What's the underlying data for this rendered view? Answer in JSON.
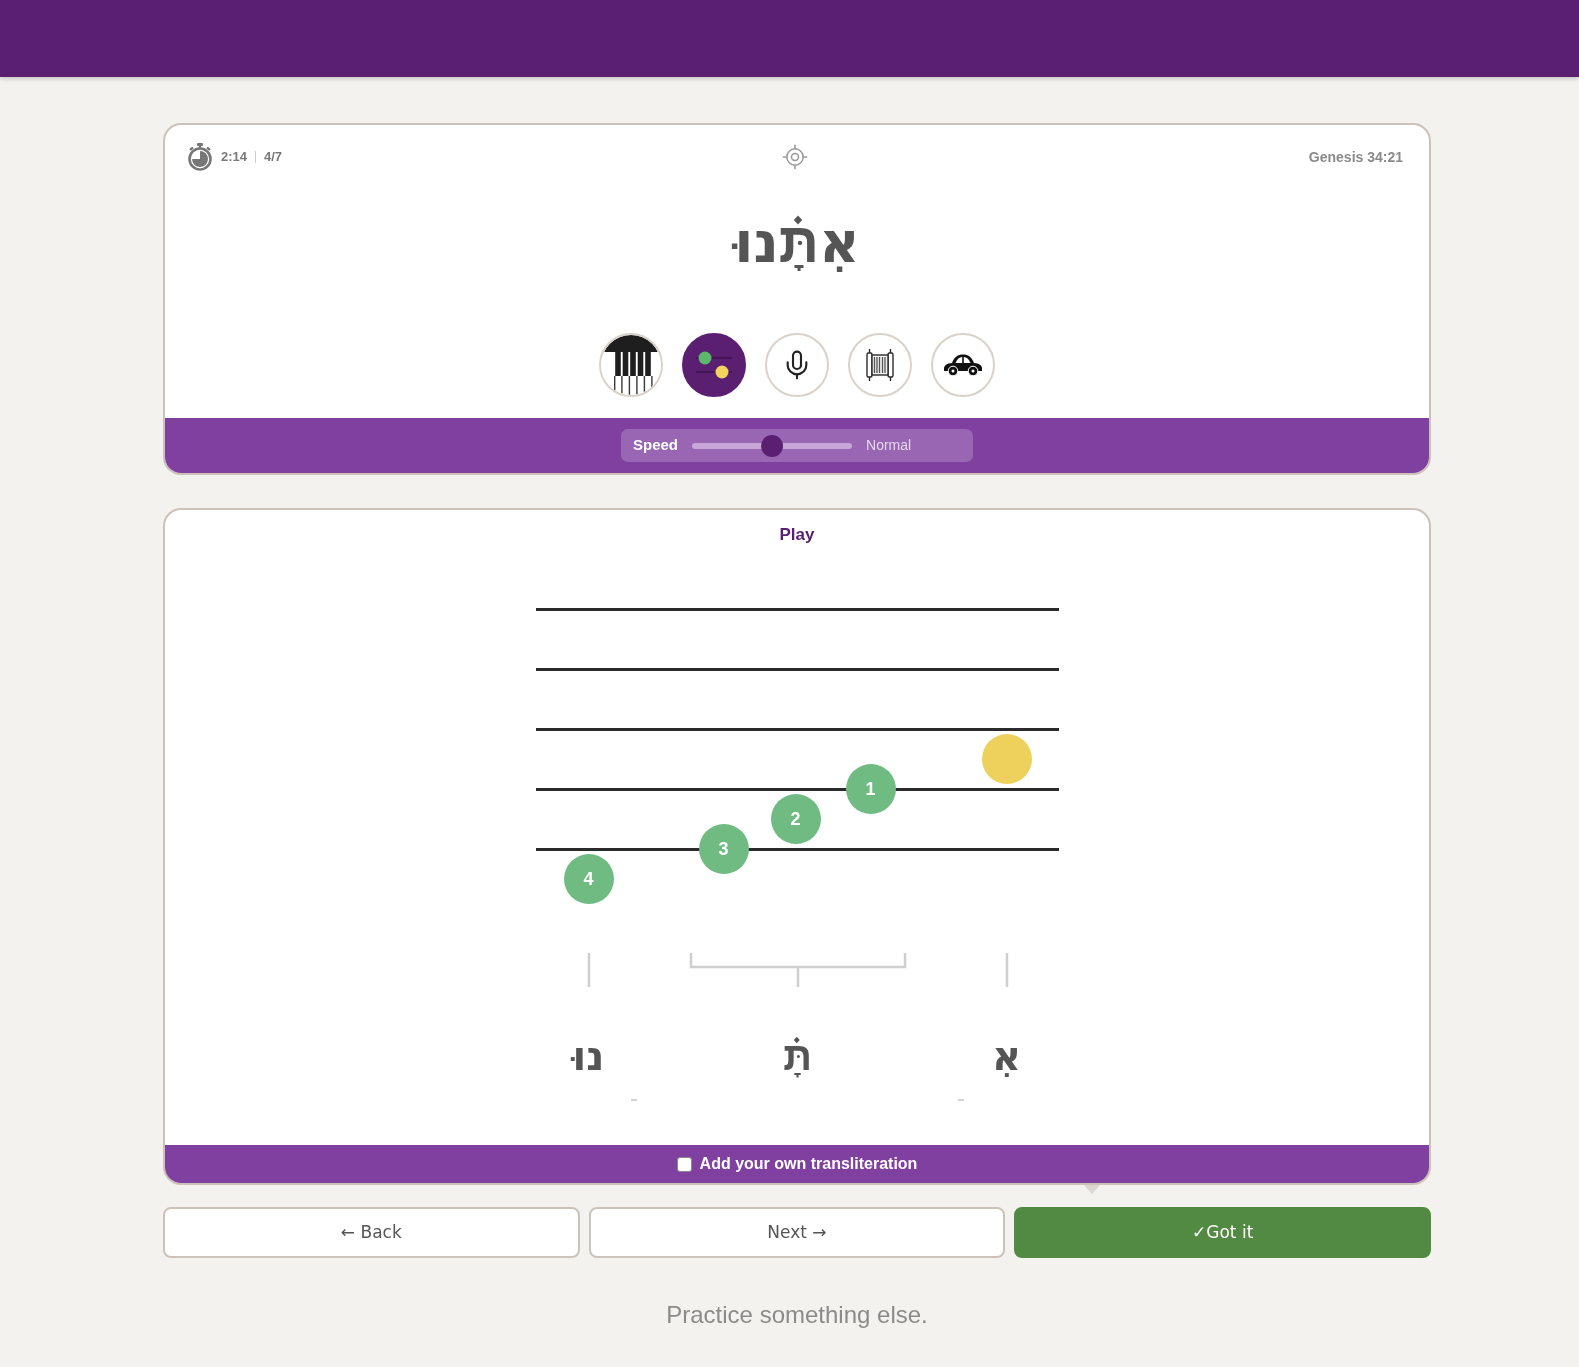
{
  "word_card": {
    "timer": "2:14",
    "progress": "4/7",
    "reference": "Genesis 34:21",
    "word": "אִתָּ֗נוּ",
    "modes": [
      {
        "kind": "piano",
        "selected": false
      },
      {
        "kind": "notes",
        "selected": true
      },
      {
        "kind": "microphone",
        "selected": false
      },
      {
        "kind": "scroll",
        "selected": false
      },
      {
        "kind": "car",
        "selected": false
      }
    ],
    "speed": {
      "label": "Speed",
      "level": 0.5,
      "reading": "Normal"
    }
  },
  "play_card": {
    "title": "Play",
    "notes": [
      {
        "color": "#eed15d"
      },
      {
        "label": "1",
        "color": "#6fbb82"
      },
      {
        "label": "2",
        "color": "#6fbb82"
      },
      {
        "label": "3",
        "color": "#6fbb82"
      },
      {
        "label": "4",
        "color": "#6fbb82"
      }
    ],
    "syllables": [
      "אִ",
      "תָּ֗",
      "נוּ"
    ],
    "transliteration": {
      "label": "Add your own transliteration",
      "checked": false
    }
  },
  "buttons": [
    {
      "kind": "back",
      "label": "← Back"
    },
    {
      "kind": "next",
      "label": "Next →"
    },
    {
      "kind": "primary",
      "label": "✓Got it"
    }
  ],
  "footer_link": "Practice something else."
}
